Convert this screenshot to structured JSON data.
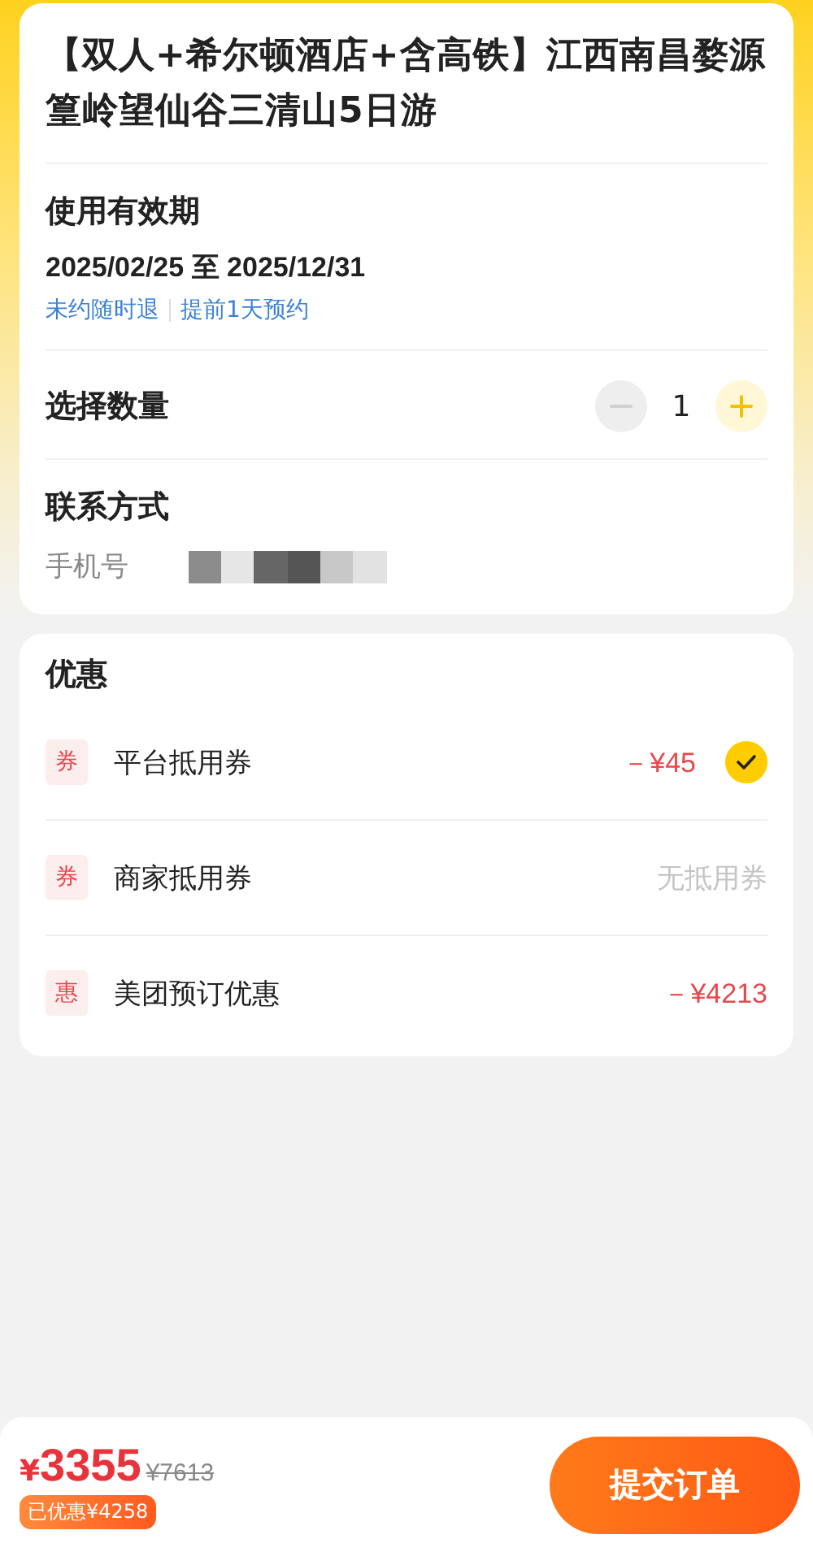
{
  "product": {
    "title": "【双人+希尔顿酒店+含高铁】江西南昌婺源篁岭望仙谷三清山5日游"
  },
  "validity": {
    "label": "使用有效期",
    "range": "2025/02/25 至 2025/12/31",
    "tags": [
      "未约随时退",
      "提前1天预约"
    ]
  },
  "quantity": {
    "label": "选择数量",
    "value": "1",
    "minus_disabled": true,
    "plus_disabled": false
  },
  "contact": {
    "label": "联系方式",
    "field_label": "手机号"
  },
  "discounts": {
    "title": "优惠",
    "items": [
      {
        "badge": "券",
        "name": "平台抵用券",
        "kind": "amount",
        "value": "－¥45",
        "checked": true
      },
      {
        "badge": "券",
        "name": "商家抵用券",
        "kind": "none",
        "value": "无抵用券"
      },
      {
        "badge": "惠",
        "name": "美团预订优惠",
        "kind": "amount",
        "value": "－¥4213"
      }
    ]
  },
  "footer": {
    "currency": "¥",
    "price": "3355",
    "original_price": "¥7613",
    "saved": "已优惠¥4258",
    "submit": "提交订单"
  }
}
